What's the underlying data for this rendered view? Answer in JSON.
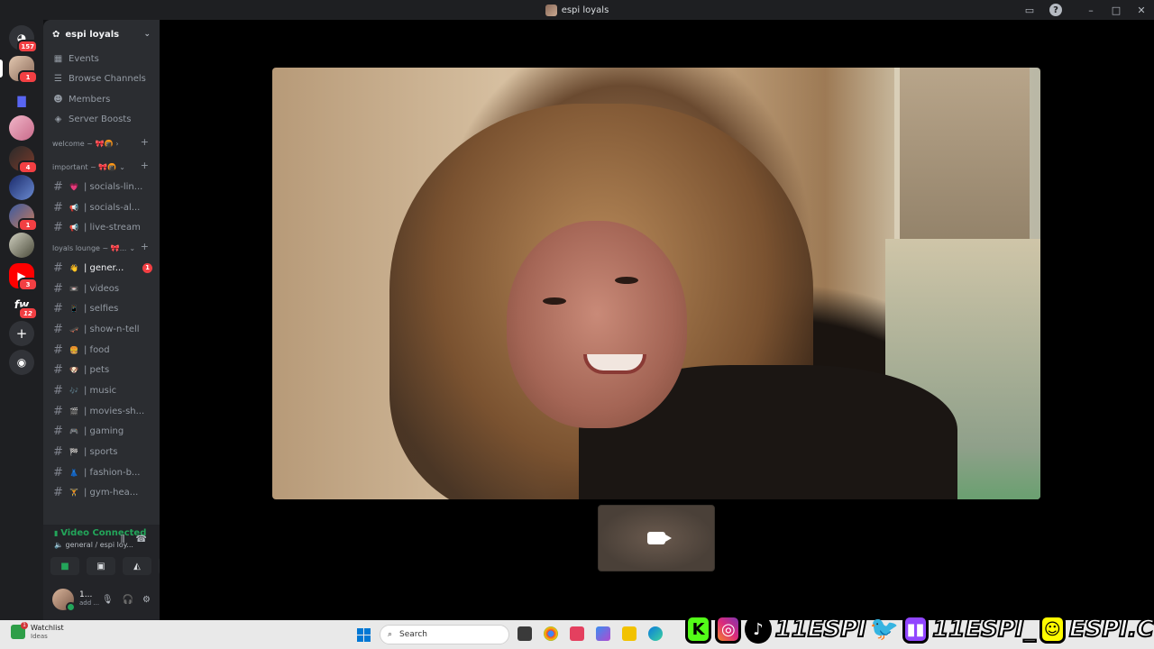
{
  "window": {
    "title": "espi loyals"
  },
  "server_rail": {
    "home_badge": "157",
    "servers": [
      {
        "name": "server-1",
        "badge": "1"
      },
      {
        "name": "server-folder",
        "badge": ""
      },
      {
        "name": "server-3",
        "badge": ""
      },
      {
        "name": "server-4",
        "badge": "4"
      },
      {
        "name": "server-5",
        "badge": ""
      },
      {
        "name": "server-6",
        "badge": "1"
      },
      {
        "name": "server-7",
        "badge": ""
      },
      {
        "name": "server-youtube",
        "badge": "3"
      },
      {
        "name": "server-fw",
        "badge": "12"
      }
    ],
    "fw_label": "fw"
  },
  "sidebar": {
    "server_name": "espi loyals",
    "menu": [
      "Events",
      "Browse Channels",
      "Members",
      "Server Boosts"
    ],
    "categories": {
      "welcome": "welcome ~ 🎀🍘",
      "important": "important ~ 🎀🍘",
      "loyals": "loyals lounge ~ 🎀..."
    },
    "important_channels": [
      {
        "emoji": "💗",
        "name": "| socials-lin..."
      },
      {
        "emoji": "📢",
        "name": "| socials-al..."
      },
      {
        "emoji": "📢",
        "name": "| live-stream"
      }
    ],
    "loyals_channels": [
      {
        "emoji": "👋",
        "name": "| gener...",
        "badge": "1"
      },
      {
        "emoji": "📼",
        "name": "| videos"
      },
      {
        "emoji": "📱",
        "name": "| selfies"
      },
      {
        "emoji": "🛹",
        "name": "| show-n-tell"
      },
      {
        "emoji": "🍔",
        "name": "| food"
      },
      {
        "emoji": "🐶",
        "name": "| pets"
      },
      {
        "emoji": "🎶",
        "name": "| music"
      },
      {
        "emoji": "🎬",
        "name": "| movies-sh..."
      },
      {
        "emoji": "🎮",
        "name": "| gaming"
      },
      {
        "emoji": "🏁",
        "name": "| sports"
      },
      {
        "emoji": "👗",
        "name": "| fashion-b..."
      },
      {
        "emoji": "🏋",
        "name": "| gym-hea..."
      }
    ]
  },
  "voice_panel": {
    "status": "Video Connected",
    "channel": "general / espi loy..."
  },
  "user_panel": {
    "name": "1...",
    "status": "add ..."
  },
  "taskbar": {
    "watchlist_title": "Watchlist",
    "watchlist_sub": "Ideas",
    "search_placeholder": "Search"
  },
  "overlay": {
    "kick_letter": "K",
    "handle1": "11ESPI",
    "handle2": "11ESPI_",
    "handle3": "ESPI.C"
  },
  "colors": {
    "connected": "#23a55a",
    "badge": "#f23f43",
    "twitter": "#1d9bf0",
    "twitch": "#9146ff",
    "snapchat": "#fffc00",
    "kick": "#53fc18"
  }
}
